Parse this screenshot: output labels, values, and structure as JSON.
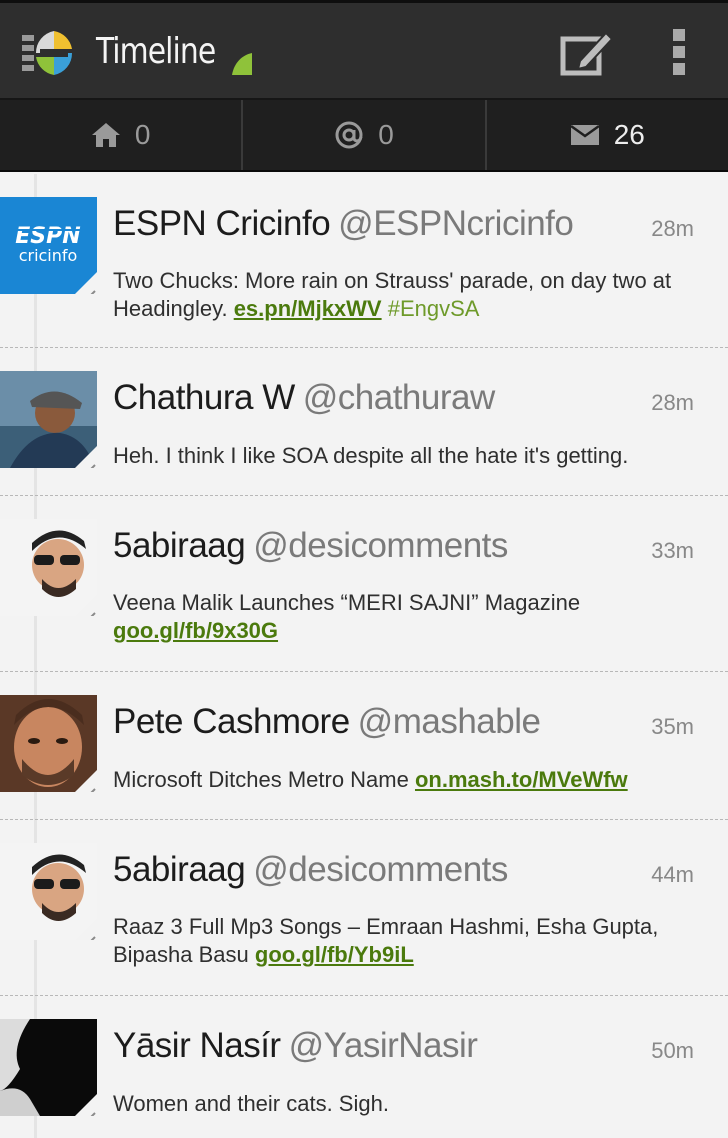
{
  "header": {
    "title": "Timeline",
    "icons": {
      "logo": "app-logo-icon",
      "compose": "compose-icon",
      "overflow": "overflow-menu-icon"
    }
  },
  "stats": [
    {
      "icon": "home-icon",
      "value": "0"
    },
    {
      "icon": "at-mention-icon",
      "value": "0"
    },
    {
      "icon": "envelope-icon",
      "value": "26"
    }
  ],
  "colors": {
    "link": "#4b7a0d",
    "hashtag": "#6e9a2a",
    "actionbar": "#2e2e2e",
    "accent": "#8fc23a"
  },
  "tweets": [
    {
      "name": "ESPN Cricinfo",
      "handle": "@ESPNcricinfo",
      "time": "28m",
      "text": "Two Chucks: More rain on Strauss' parade, on day two at Headingley.",
      "link": "es.pn/MjkxWV",
      "tag": "#EngvSA",
      "avatar_logo_top": "ESPN",
      "avatar_logo_bottom": "cricinfo"
    },
    {
      "name": "Chathura W",
      "handle": "@chathuraw",
      "time": "28m",
      "text": "Heh. I think I like SOA despite all the hate it's getting."
    },
    {
      "name": "5abiraag",
      "handle": "@desicomments",
      "time": "33m",
      "text": "Veena Malik Launches “MERI SAJNI” Magazine",
      "link": "goo.gl/fb/9x30G"
    },
    {
      "name": "Pete Cashmore",
      "handle": "@mashable",
      "time": "35m",
      "text": "Microsoft Ditches Metro Name",
      "link": "on.mash.to/MVeWfw"
    },
    {
      "name": "5abiraag",
      "handle": "@desicomments",
      "time": "44m",
      "text": "Raaz 3 Full Mp3 Songs – Emraan Hashmi, Esha Gupta, Bipasha Basu",
      "link": "goo.gl/fb/Yb9iL"
    },
    {
      "name": "Yāsir Nasír",
      "handle": "@YasirNasir",
      "time": "50m",
      "text": "Women and their cats. Sigh."
    }
  ]
}
